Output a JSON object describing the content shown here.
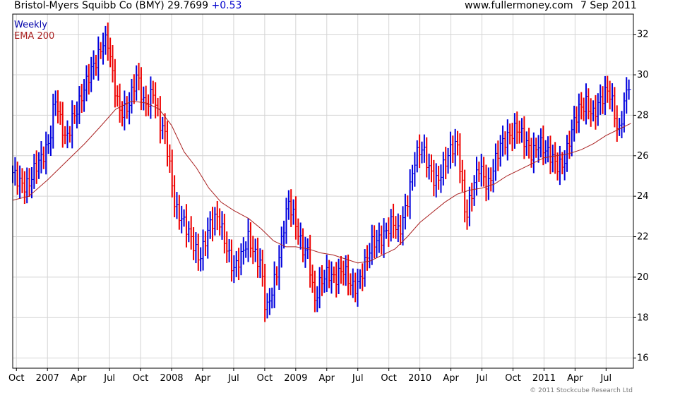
{
  "header": {
    "title": "Bristol-Myers Squibb Co (BMY) 29.7699",
    "change": "+0.53",
    "site": "www.fullermoney.com",
    "date": "7 Sep 2011"
  },
  "legend": {
    "weekly": "Weekly",
    "ema": "EMA 200"
  },
  "copyright": "© 2011 Stockcube Research Ltd",
  "colors": {
    "up": "#0000dd",
    "down": "#ee0000",
    "ema": "#aa2222",
    "grid": "#d4d4d4",
    "axis": "#000000"
  },
  "chart_data": {
    "type": "line",
    "subtype": "weekly price bars (high-low / close) with EMA 200",
    "y_range": [
      15.5,
      33
    ],
    "y_ticks": [
      16,
      18,
      20,
      22,
      24,
      26,
      28,
      30,
      32
    ],
    "x_range": [
      2006.72,
      2011.72
    ],
    "x_ticks": [
      {
        "label": "Oct",
        "x": 2006.75
      },
      {
        "label": "2007",
        "x": 2007.0
      },
      {
        "label": "Apr",
        "x": 2007.25
      },
      {
        "label": "Jul",
        "x": 2007.5
      },
      {
        "label": "Oct",
        "x": 2007.75
      },
      {
        "label": "2008",
        "x": 2008.0
      },
      {
        "label": "Apr",
        "x": 2008.25
      },
      {
        "label": "Jul",
        "x": 2008.5
      },
      {
        "label": "Oct",
        "x": 2008.75
      },
      {
        "label": "2009",
        "x": 2009.0
      },
      {
        "label": "Apr",
        "x": 2009.25
      },
      {
        "label": "Jul",
        "x": 2009.5
      },
      {
        "label": "Oct",
        "x": 2009.75
      },
      {
        "label": "2010",
        "x": 2010.0
      },
      {
        "label": "Apr",
        "x": 2010.25
      },
      {
        "label": "Jul",
        "x": 2010.5
      },
      {
        "label": "Oct",
        "x": 2010.75
      },
      {
        "label": "2011",
        "x": 2011.0
      },
      {
        "label": "Apr",
        "x": 2011.25
      },
      {
        "label": "Jul",
        "x": 2011.5
      }
    ],
    "price_anchors": [
      [
        2006.72,
        25.0
      ],
      [
        2006.85,
        24.6
      ],
      [
        2006.95,
        25.8
      ],
      [
        2007.02,
        27.0
      ],
      [
        2007.06,
        29.0
      ],
      [
        2007.1,
        27.6
      ],
      [
        2007.15,
        26.6
      ],
      [
        2007.2,
        28.0
      ],
      [
        2007.3,
        29.2
      ],
      [
        2007.38,
        30.6
      ],
      [
        2007.45,
        31.8
      ],
      [
        2007.49,
        31.5
      ],
      [
        2007.53,
        29.5
      ],
      [
        2007.58,
        28.2
      ],
      [
        2007.65,
        28.6
      ],
      [
        2007.72,
        29.8
      ],
      [
        2007.78,
        28.4
      ],
      [
        2007.85,
        29.4
      ],
      [
        2007.9,
        27.6
      ],
      [
        2007.95,
        26.8
      ],
      [
        2008.0,
        24.8
      ],
      [
        2008.03,
        23.6
      ],
      [
        2008.08,
        23.0
      ],
      [
        2008.15,
        21.8
      ],
      [
        2008.22,
        21.0
      ],
      [
        2008.3,
        22.5
      ],
      [
        2008.38,
        22.8
      ],
      [
        2008.45,
        21.5
      ],
      [
        2008.5,
        20.4
      ],
      [
        2008.56,
        20.8
      ],
      [
        2008.62,
        22.0
      ],
      [
        2008.68,
        21.2
      ],
      [
        2008.72,
        20.6
      ],
      [
        2008.76,
        18.0
      ],
      [
        2008.8,
        19.0
      ],
      [
        2008.85,
        20.5
      ],
      [
        2008.9,
        22.5
      ],
      [
        2008.94,
        23.6
      ],
      [
        2009.0,
        22.5
      ],
      [
        2009.05,
        21.6
      ],
      [
        2009.1,
        21.4
      ],
      [
        2009.15,
        18.6
      ],
      [
        2009.2,
        19.6
      ],
      [
        2009.26,
        20.4
      ],
      [
        2009.32,
        20.0
      ],
      [
        2009.38,
        20.2
      ],
      [
        2009.45,
        19.6
      ],
      [
        2009.5,
        19.8
      ],
      [
        2009.56,
        20.6
      ],
      [
        2009.62,
        21.6
      ],
      [
        2009.7,
        22.2
      ],
      [
        2009.78,
        22.6
      ],
      [
        2009.83,
        22.0
      ],
      [
        2009.9,
        24.0
      ],
      [
        2009.96,
        25.8
      ],
      [
        2010.02,
        26.2
      ],
      [
        2010.08,
        25.4
      ],
      [
        2010.14,
        24.8
      ],
      [
        2010.2,
        25.4
      ],
      [
        2010.26,
        26.4
      ],
      [
        2010.3,
        26.8
      ],
      [
        2010.33,
        25.4
      ],
      [
        2010.37,
        22.8
      ],
      [
        2010.42,
        24.0
      ],
      [
        2010.48,
        25.6
      ],
      [
        2010.55,
        24.6
      ],
      [
        2010.6,
        25.4
      ],
      [
        2010.65,
        26.4
      ],
      [
        2010.72,
        27.2
      ],
      [
        2010.78,
        27.4
      ],
      [
        2010.84,
        26.6
      ],
      [
        2010.9,
        26.2
      ],
      [
        2010.96,
        26.8
      ],
      [
        2011.02,
        26.0
      ],
      [
        2011.1,
        25.6
      ],
      [
        2011.16,
        25.8
      ],
      [
        2011.22,
        27.0
      ],
      [
        2011.28,
        28.2
      ],
      [
        2011.34,
        28.8
      ],
      [
        2011.4,
        28.0
      ],
      [
        2011.46,
        28.6
      ],
      [
        2011.52,
        29.4
      ],
      [
        2011.56,
        28.6
      ],
      [
        2011.6,
        27.0
      ],
      [
        2011.64,
        28.2
      ],
      [
        2011.68,
        29.4
      ],
      [
        2011.7,
        29.77
      ]
    ],
    "ema_anchors": [
      [
        2006.72,
        23.8
      ],
      [
        2006.85,
        24.0
      ],
      [
        2007.0,
        24.8
      ],
      [
        2007.15,
        25.7
      ],
      [
        2007.3,
        26.6
      ],
      [
        2007.42,
        27.4
      ],
      [
        2007.55,
        28.3
      ],
      [
        2007.68,
        28.7
      ],
      [
        2007.8,
        28.6
      ],
      [
        2007.9,
        28.3
      ],
      [
        2008.0,
        27.5
      ],
      [
        2008.1,
        26.2
      ],
      [
        2008.2,
        25.4
      ],
      [
        2008.3,
        24.4
      ],
      [
        2008.4,
        23.7
      ],
      [
        2008.5,
        23.3
      ],
      [
        2008.62,
        22.9
      ],
      [
        2008.72,
        22.4
      ],
      [
        2008.82,
        21.8
      ],
      [
        2008.92,
        21.5
      ],
      [
        2009.0,
        21.5
      ],
      [
        2009.1,
        21.4
      ],
      [
        2009.2,
        21.2
      ],
      [
        2009.3,
        21.1
      ],
      [
        2009.4,
        20.9
      ],
      [
        2009.5,
        20.7
      ],
      [
        2009.6,
        20.8
      ],
      [
        2009.7,
        21.1
      ],
      [
        2009.8,
        21.4
      ],
      [
        2009.9,
        22.0
      ],
      [
        2010.0,
        22.7
      ],
      [
        2010.1,
        23.2
      ],
      [
        2010.2,
        23.7
      ],
      [
        2010.3,
        24.1
      ],
      [
        2010.4,
        24.3
      ],
      [
        2010.5,
        24.4
      ],
      [
        2010.6,
        24.6
      ],
      [
        2010.7,
        25.0
      ],
      [
        2010.8,
        25.3
      ],
      [
        2010.9,
        25.6
      ],
      [
        2011.0,
        25.9
      ],
      [
        2011.1,
        26.0
      ],
      [
        2011.2,
        26.1
      ],
      [
        2011.3,
        26.3
      ],
      [
        2011.4,
        26.6
      ],
      [
        2011.5,
        27.0
      ],
      [
        2011.6,
        27.3
      ],
      [
        2011.7,
        27.6
      ]
    ]
  }
}
